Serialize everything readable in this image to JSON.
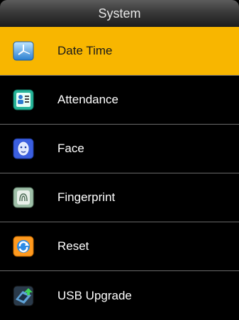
{
  "title": "System",
  "menu": {
    "items": [
      {
        "label": "Date Time",
        "icon": "clock-icon",
        "selected": true
      },
      {
        "label": "Attendance",
        "icon": "attendance-icon",
        "selected": false
      },
      {
        "label": "Face",
        "icon": "face-icon",
        "selected": false
      },
      {
        "label": "Fingerprint",
        "icon": "fingerprint-icon",
        "selected": false
      },
      {
        "label": "Reset",
        "icon": "reset-icon",
        "selected": false
      },
      {
        "label": "USB Upgrade",
        "icon": "usb-upgrade-icon",
        "selected": false
      }
    ]
  },
  "colors": {
    "selected_bg": "#f8b600",
    "background": "#000000",
    "divider": "#6a6a6a"
  }
}
